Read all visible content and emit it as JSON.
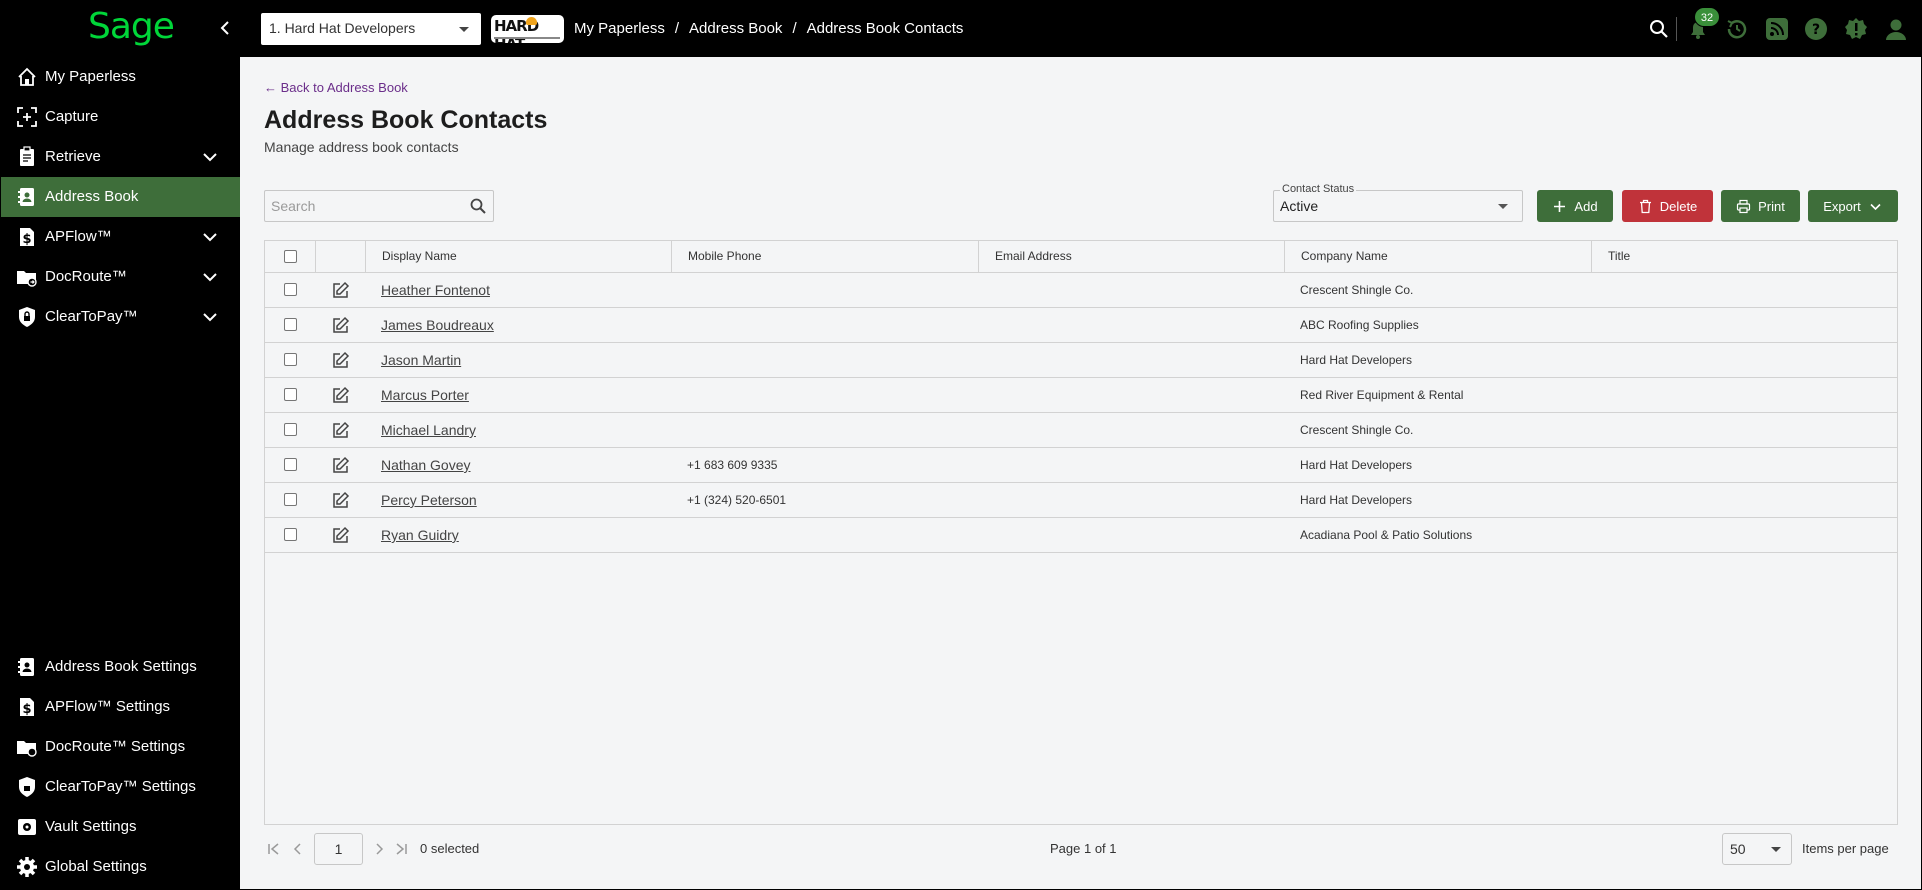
{
  "app": {
    "logo_text": "Sage",
    "accent": "#00d639",
    "active_green": "#3e6e3a",
    "danger_red": "#c0333a"
  },
  "topbar": {
    "company": "1. Hard Hat Developers",
    "brand_logo_text": "HARD HAT",
    "breadcrumb": [
      "My Paperless",
      "Address Book",
      "Address Book Contacts"
    ],
    "notification_count": "32",
    "icons": [
      "search-icon",
      "bell-icon",
      "history-icon",
      "rss-icon",
      "help-icon",
      "alert-icon",
      "user-icon"
    ]
  },
  "sidebar": {
    "items": [
      {
        "label": "My Paperless",
        "icon": "home-icon",
        "expandable": false
      },
      {
        "label": "Capture",
        "icon": "capture-icon",
        "expandable": false
      },
      {
        "label": "Retrieve",
        "icon": "clipboard-icon",
        "expandable": true
      },
      {
        "label": "Address Book",
        "icon": "address-book-icon",
        "expandable": false,
        "active": true
      },
      {
        "label": "APFlow™",
        "icon": "dollar-doc-icon",
        "expandable": true
      },
      {
        "label": "DocRoute™",
        "icon": "folder-route-icon",
        "expandable": true
      },
      {
        "label": "ClearToPay™",
        "icon": "lock-shield-icon",
        "expandable": true
      }
    ],
    "settings": [
      {
        "label": "Address Book Settings",
        "icon": "address-book-icon"
      },
      {
        "label": "APFlow™ Settings",
        "icon": "dollar-doc-icon"
      },
      {
        "label": "DocRoute™ Settings",
        "icon": "folder-route-icon"
      },
      {
        "label": "ClearToPay™ Settings",
        "icon": "lock-shield-icon"
      },
      {
        "label": "Vault Settings",
        "icon": "vault-icon"
      },
      {
        "label": "Global Settings",
        "icon": "gear-icon"
      }
    ]
  },
  "main": {
    "back_link": "← Back to Address Book",
    "title": "Address Book Contacts",
    "subtitle": "Manage address book contacts",
    "search_placeholder": "Search",
    "contact_status_label": "Contact Status",
    "contact_status_value": "Active",
    "buttons": {
      "add": "Add",
      "delete": "Delete",
      "print": "Print",
      "export": "Export"
    }
  },
  "table": {
    "columns": [
      "Display Name",
      "Mobile Phone",
      "Email Address",
      "Company Name",
      "Title"
    ],
    "rows": [
      {
        "name": "Heather Fontenot",
        "mobile": "",
        "email": "",
        "company": "Crescent Shingle Co.",
        "title": ""
      },
      {
        "name": "James Boudreaux",
        "mobile": "",
        "email": "",
        "company": "ABC Roofing Supplies",
        "title": ""
      },
      {
        "name": "Jason Martin",
        "mobile": "",
        "email": "",
        "company": "Hard Hat Developers",
        "title": ""
      },
      {
        "name": "Marcus Porter",
        "mobile": "",
        "email": "",
        "company": "Red River Equipment & Rental",
        "title": ""
      },
      {
        "name": "Michael Landry",
        "mobile": "",
        "email": "",
        "company": "Crescent Shingle Co.",
        "title": ""
      },
      {
        "name": "Nathan Govey",
        "mobile": "+1 683 609 9335",
        "email": "",
        "company": "Hard Hat Developers",
        "title": ""
      },
      {
        "name": "Percy Peterson",
        "mobile": "+1 (324) 520-6501",
        "email": "",
        "company": "Hard Hat Developers",
        "title": ""
      },
      {
        "name": "Ryan Guidry",
        "mobile": "",
        "email": "",
        "company": "Acadiana Pool & Patio Solutions",
        "title": ""
      }
    ]
  },
  "pager": {
    "current_page": "1",
    "selected": "0 selected",
    "page_of": "Page 1 of 1",
    "items_per_page": "50",
    "items_per_page_label": "Items per page"
  }
}
